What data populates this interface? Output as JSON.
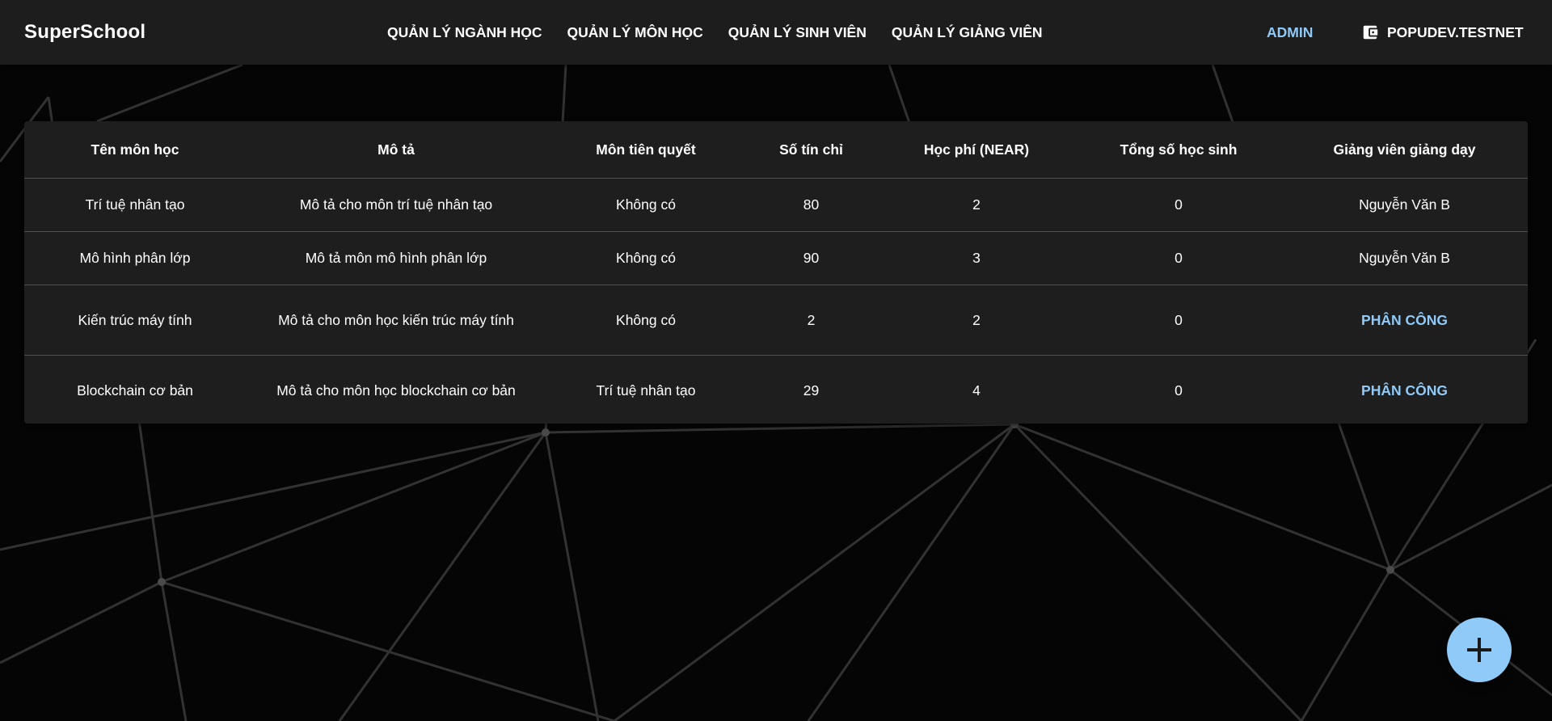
{
  "app": {
    "brand": "SuperSchool"
  },
  "nav": [
    {
      "label": "QUẢN LÝ NGÀNH HỌC"
    },
    {
      "label": "QUẢN LÝ MÔN HỌC"
    },
    {
      "label": "QUẢN LÝ SINH VIÊN"
    },
    {
      "label": "QUẢN LÝ GIẢNG VIÊN"
    }
  ],
  "header": {
    "role": "ADMIN",
    "account": "POPUDEV.TESTNET",
    "account_icon": "wallet-icon"
  },
  "table": {
    "columns": [
      "Tên môn học",
      "Mô tả",
      "Môn tiên quyết",
      "Số tín chỉ",
      "Học phí (NEAR)",
      "Tổng số học sinh",
      "Giảng viên giảng dạy"
    ],
    "rows": [
      {
        "name": "Trí tuệ nhân tạo",
        "description": "Mô tả cho môn trí tuệ nhân tạo",
        "prerequisite": "Không có",
        "credits": "80",
        "fee": "2",
        "students": "0",
        "lecturer": "Nguyễn Văn B"
      },
      {
        "name": "Mô hình phân lớp",
        "description": "Mô tả môn mô hình phân lớp",
        "prerequisite": "Không có",
        "credits": "90",
        "fee": "3",
        "students": "0",
        "lecturer": "Nguyễn Văn B"
      },
      {
        "name": "Kiến trúc máy tính",
        "description": "Mô tả cho môn học kiến trúc máy tính",
        "prerequisite": "Không có",
        "credits": "2",
        "fee": "2",
        "students": "0",
        "assign_label": "PHÂN CÔNG"
      },
      {
        "name": "Blockchain cơ bản",
        "description": "Mô tả cho môn học blockchain cơ bản",
        "prerequisite": "Trí tuệ nhân tạo",
        "credits": "29",
        "fee": "4",
        "students": "0",
        "assign_label": "PHÂN CÔNG"
      }
    ]
  },
  "fab": {
    "icon": "plus-icon"
  },
  "colors": {
    "appbar": "#1d1d1d",
    "accent": "#90caf9",
    "paper": "#1e1e1e",
    "background": "#050505"
  }
}
